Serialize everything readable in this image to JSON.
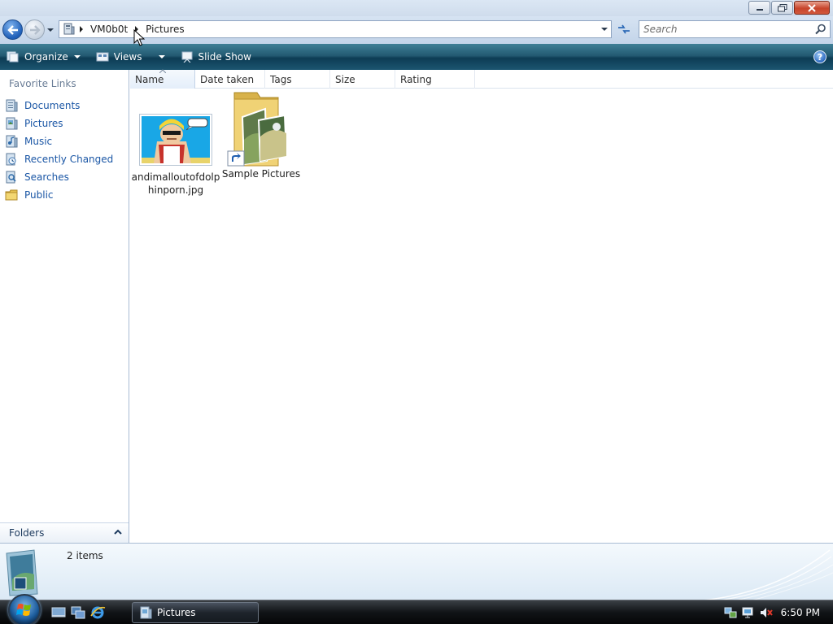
{
  "window": {
    "title": "Pictures",
    "buttons": {
      "minimize": "",
      "maximize": "",
      "close": ""
    }
  },
  "address": {
    "crumbs": [
      "VM0b0t",
      "Pictures"
    ]
  },
  "search": {
    "placeholder": "Search"
  },
  "commandbar": {
    "organize": "Organize",
    "views": "Views",
    "slideshow": "Slide Show",
    "help": "?"
  },
  "navpane": {
    "favorites_title": "Favorite Links",
    "items": [
      {
        "label": "Documents",
        "icon": "documents-icon"
      },
      {
        "label": "Pictures",
        "icon": "pictures-icon"
      },
      {
        "label": "Music",
        "icon": "music-icon"
      },
      {
        "label": "Recently Changed",
        "icon": "recently-changed-icon"
      },
      {
        "label": "Searches",
        "icon": "searches-icon"
      },
      {
        "label": "Public",
        "icon": "public-folder-icon"
      }
    ],
    "folders_label": "Folders"
  },
  "columns": [
    "Name",
    "Date taken",
    "Tags",
    "Size",
    "Rating"
  ],
  "files": [
    {
      "name_line1": "andimalloutofdolp",
      "name_line2": "hinporn.jpg",
      "type": "image"
    },
    {
      "name_line1": "Sample Pictures",
      "name_line2": "",
      "type": "folder-shortcut"
    }
  ],
  "details": {
    "count": "2 items"
  },
  "taskbar": {
    "task_label": "Pictures",
    "clock": "6:50 PM"
  },
  "colors": {
    "link_blue": "#1a56a5",
    "commandbar": "#1b5570",
    "taskbar": "#111417"
  }
}
